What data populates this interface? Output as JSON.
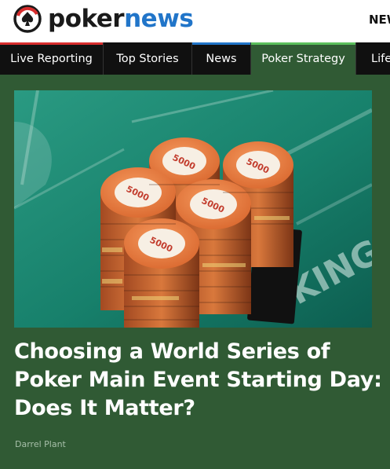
{
  "brand": {
    "name_part1": "poker",
    "name_part2": "news",
    "logo_icon": "pokernews-spade-icon",
    "colors": {
      "blue": "#2175c9",
      "red": "#d72d2d",
      "dark": "#1a1a1a"
    }
  },
  "header": {
    "right_link": "NEW"
  },
  "nav": {
    "items": [
      {
        "label": "Live Reporting",
        "accent": "#d72d2d",
        "active": false
      },
      {
        "label": "Top Stories",
        "accent": "",
        "active": false
      },
      {
        "label": "News",
        "accent": "#2175c9",
        "active": false
      },
      {
        "label": "Poker Strategy",
        "accent": "#5bbf5c",
        "active": true
      },
      {
        "label": "Life",
        "accent": "",
        "active": false
      }
    ]
  },
  "article": {
    "image_alt": "Stacks of World Series of Poker Main Event chips",
    "chip_text": "5000",
    "table_text": "KING",
    "headline": "Choosing a World Series of Poker Main Event Starting Day: Does It Matter?",
    "author": "Darrel Plant"
  },
  "colors": {
    "page_bg": "#305a34",
    "nav_bg": "#101010",
    "felt": "#1c7d6a",
    "chip": "#e4773f"
  }
}
